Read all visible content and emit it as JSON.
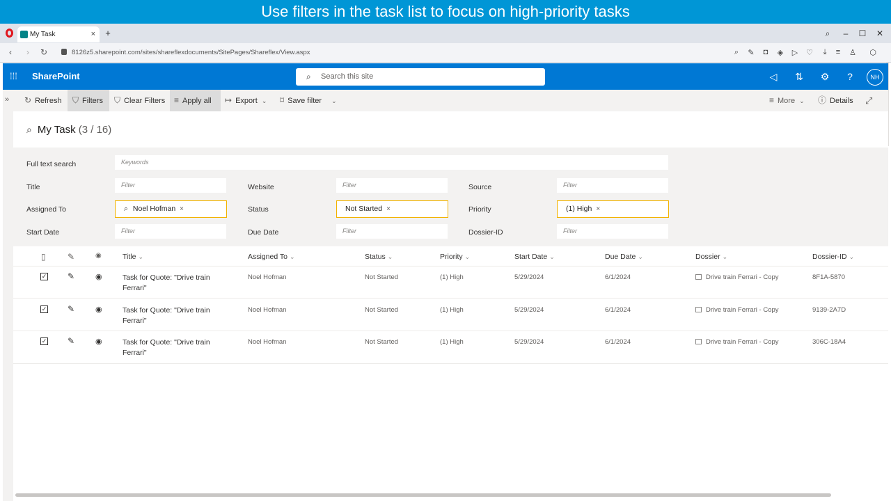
{
  "banner": {
    "text": "Use filters in the task list to focus on high-priority tasks"
  },
  "browser": {
    "tab_title": "My Task",
    "tab_close": "×",
    "new_tab": "+",
    "url": "8126z5.sharepoint.com/sites/shareflexdocuments/SitePages/Shareflex/View.aspx"
  },
  "suitebar": {
    "brand": "SharePoint",
    "search_placeholder": "Search this site",
    "avatar_initials": "NH"
  },
  "commands": {
    "refresh": "Refresh",
    "filters": "Filters",
    "clear_filters": "Clear Filters",
    "apply_all": "Apply all",
    "export": "Export",
    "save_filter": "Save filter",
    "more": "More",
    "details": "Details"
  },
  "list": {
    "title": "My Task",
    "count": "(3 / 16)"
  },
  "filters": {
    "full_text_label": "Full text search",
    "full_text_placeholder": "Keywords",
    "title_label": "Title",
    "website_label": "Website",
    "source_label": "Source",
    "assigned_label": "Assigned To",
    "status_label": "Status",
    "priority_label": "Priority",
    "start_label": "Start Date",
    "due_label": "Due Date",
    "dossier_id_label": "Dossier-ID",
    "placeholder": "Filter",
    "assigned_value": "Noel Hofman",
    "status_value": "Not Started",
    "priority_value": "(1) High",
    "remove": "×"
  },
  "table": {
    "columns": [
      "Title",
      "Assigned To",
      "Status",
      "Priority",
      "Start Date",
      "Due Date",
      "Dossier",
      "Dossier-ID"
    ],
    "rows": [
      {
        "title": "Task for Quote: \"Drive train Ferrari\"",
        "assigned": "Noel Hofman",
        "status": "Not Started",
        "priority": "(1) High",
        "start": "5/29/2024",
        "due": "6/1/2024",
        "dossier": "Drive train Ferrari - Copy",
        "dossier_id": "8F1A-5870"
      },
      {
        "title": "Task for Quote: \"Drive train Ferrari\"",
        "assigned": "Noel Hofman",
        "status": "Not Started",
        "priority": "(1) High",
        "start": "5/29/2024",
        "due": "6/1/2024",
        "dossier": "Drive train Ferrari - Copy",
        "dossier_id": "9139-2A7D"
      },
      {
        "title": "Task for Quote: \"Drive train Ferrari\"",
        "assigned": "Noel Hofman",
        "status": "Not Started",
        "priority": "(1) High",
        "start": "5/29/2024",
        "due": "6/1/2024",
        "dossier": "Drive train Ferrari - Copy",
        "dossier_id": "306C-18A4"
      }
    ]
  },
  "colors": {
    "banner": "#0096d6",
    "suitebar": "#0078d4",
    "filter_highlight": "#f2b300"
  }
}
